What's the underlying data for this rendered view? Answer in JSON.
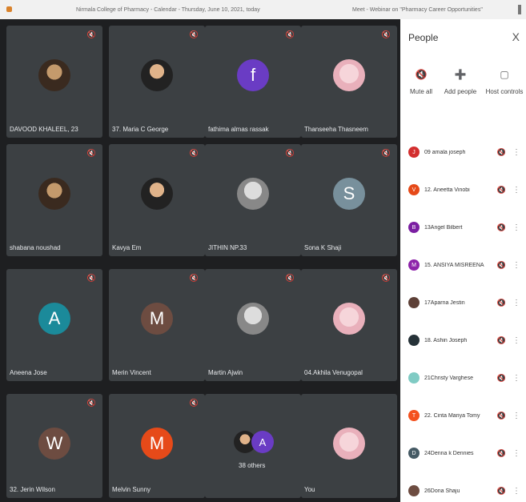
{
  "window": {
    "tab_calendar": "Nirmala College of Pharmacy - Calendar - Thursday, June 10, 2021, today",
    "tab_meet": "Meet - Webinar on \"Pharmacy Career Opportunities\""
  },
  "tiles": [
    {
      "name": "DAVOOD KHALEEL, 23",
      "avatar": "photo",
      "muted": true
    },
    {
      "name": "37. Maria C George",
      "avatar": "photo",
      "muted": true
    },
    {
      "name": "fathima almas rassak",
      "avatar": "f",
      "color": "#6a3cc4",
      "muted": true
    },
    {
      "name": "Thanseeha Thasneem",
      "avatar": "photo",
      "muted": true
    },
    {
      "name": "shabana noushad",
      "avatar": "photo",
      "muted": true
    },
    {
      "name": "Kavya Em",
      "avatar": "photo",
      "muted": true
    },
    {
      "name": "JITHIN NP.33",
      "avatar": "photo",
      "muted": true
    },
    {
      "name": "Sona K Shaji",
      "avatar": "S",
      "color": "#78909c",
      "muted": true
    },
    {
      "name": "Aneena Jose",
      "avatar": "A",
      "color": "#1b8a9a",
      "muted": true
    },
    {
      "name": "Merin Vincent",
      "avatar": "M",
      "color": "#6d4c41",
      "muted": true
    },
    {
      "name": "Martin Ajwin",
      "avatar": "photo",
      "muted": true
    },
    {
      "name": "04.Akhila Venugopal",
      "avatar": "photo",
      "muted": true
    },
    {
      "name": "32. Jerin Wilson",
      "avatar": "W",
      "color": "#6d4c41",
      "muted": true
    },
    {
      "name": "Melvin Sunny",
      "avatar": "M",
      "color": "#e64a19",
      "muted": true
    },
    {
      "name": "38 others",
      "avatar": "others",
      "muted": false
    },
    {
      "name": "You",
      "avatar": "photo",
      "muted": false
    }
  ],
  "others_badge": "A",
  "panel": {
    "title": "People",
    "close": "X",
    "mute_all": "Mute all",
    "add_people": "Add people",
    "host_controls": "Host controls",
    "people": [
      {
        "name": "09 amala joseph",
        "initial": "J",
        "color": "#d32f2f"
      },
      {
        "name": "12. Aneetta Vinobi",
        "initial": "V",
        "color": "#e64a19"
      },
      {
        "name": "13Angel Bilbert",
        "initial": "B",
        "color": "#7b1fa2"
      },
      {
        "name": "15. ANSIYA MISREENA",
        "initial": "M",
        "color": "#8e24aa"
      },
      {
        "name": "17Aparna Jestin",
        "initial": "",
        "color": "#5d4037"
      },
      {
        "name": "18. Ashin Joseph",
        "initial": "",
        "color": "#263238"
      },
      {
        "name": "21Christy Varghese",
        "initial": "",
        "color": "#80cbc4"
      },
      {
        "name": "22. Cinta Mariya Tomy",
        "initial": "T",
        "color": "#f4511e"
      },
      {
        "name": "24Denna k Dennies",
        "initial": "D",
        "color": "#455a64"
      },
      {
        "name": "26Dona Shaju",
        "initial": "",
        "color": "#6d4c41"
      }
    ]
  }
}
